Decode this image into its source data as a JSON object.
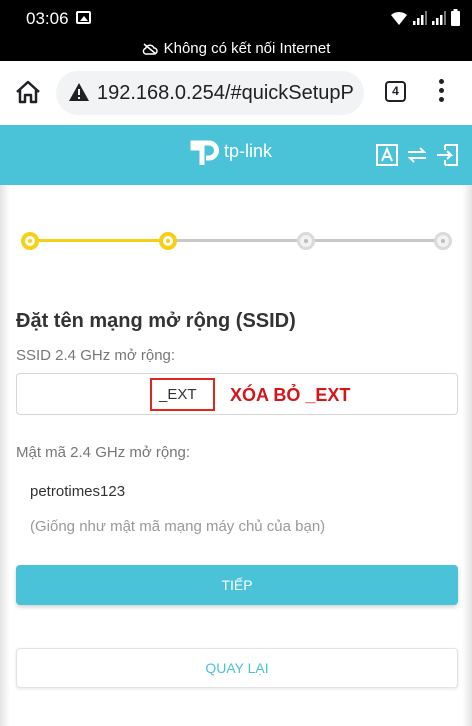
{
  "status_bar": {
    "time": "03:06"
  },
  "connection_banner": {
    "text": "Không có kết nối Internet"
  },
  "browser": {
    "url": "192.168.0.254/#quickSetupP",
    "tab_count": "4"
  },
  "header": {
    "logo_text": "tp-link"
  },
  "progress": {
    "total_steps": 4,
    "current_step": 2,
    "done_color": "#f7d015",
    "todo_color": "#c8c8c8"
  },
  "form": {
    "title": "Đặt tên mạng mở rộng (SSID)",
    "ssid_label": "SSID 2.4 GHz mở rộng:",
    "ssid_value": "_EXT",
    "annotation": "XÓA BỎ _EXT",
    "password_label": "Mật mã 2.4 GHz mở rộng:",
    "password_value": "petrotimes123",
    "password_hint": "(Giống như mật mã mạng máy chủ của bạn)",
    "next_button": "TIẾP",
    "back_button": "QUAY LẠI"
  },
  "colors": {
    "accent": "#4ac2d7",
    "annotation_red": "#d4161b"
  }
}
